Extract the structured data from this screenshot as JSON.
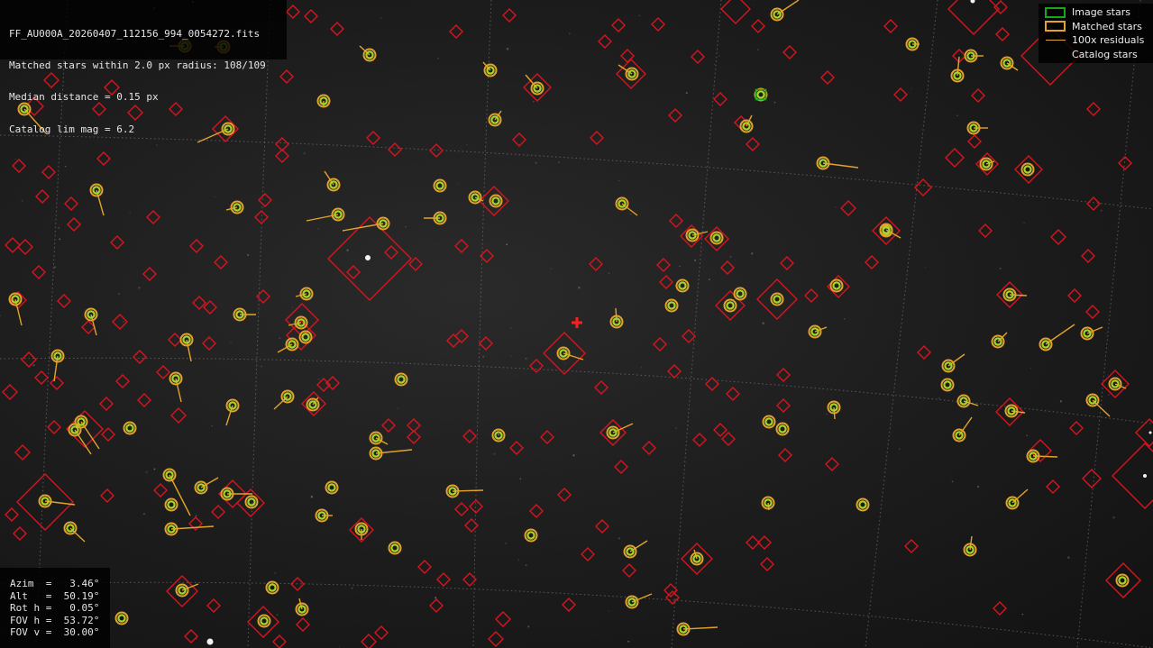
{
  "info": {
    "filename": "FF_AU000A_20260407_112156_994_0054272.fits",
    "matched": "Matched stars within 2.0 px radius: 108/109",
    "median": "Median distance = 0.15 px",
    "catalog": "Catalog lim mag = 6.2"
  },
  "legend": {
    "image_stars": "Image stars",
    "matched_stars": "Matched stars",
    "residuals": "100x residuals",
    "catalog_stars": "Catalog stars"
  },
  "pointing": {
    "azim": "3.46°",
    "alt": "50.19°",
    "rot": "0.05°",
    "fov_h": "53.72°",
    "fov_v": "30.00°"
  },
  "labels": {
    "azim": "Azim",
    "alt": "Alt",
    "rot": "Rot h",
    "fov_h": "FOV h",
    "fov_v": "FOV v"
  },
  "colors": {
    "catalog": "#d9141e",
    "matched": "#e3a32a",
    "image": "#1aa51a",
    "centroid": "#a8d42a",
    "center_marker": "#ff1e1e",
    "grid": "#8c8c8c"
  }
}
